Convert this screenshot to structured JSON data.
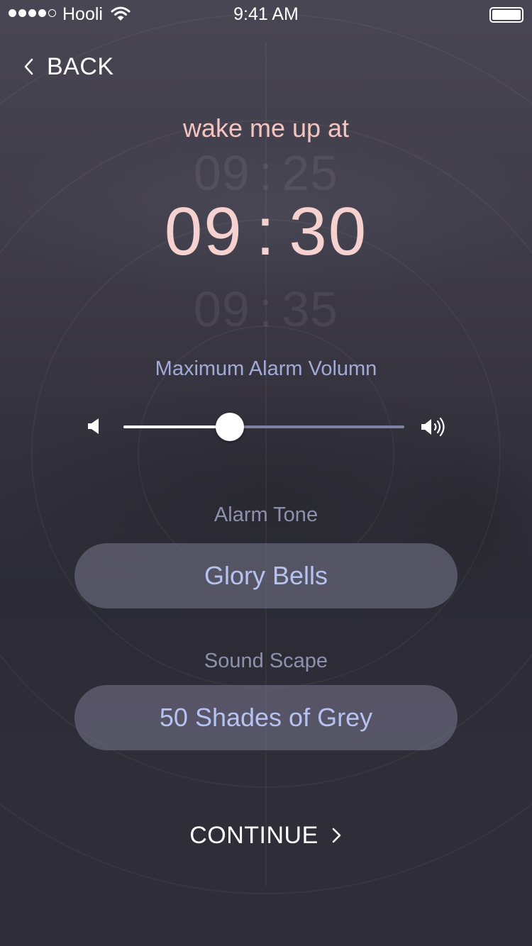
{
  "status_bar": {
    "carrier": "Hooli",
    "time": "9:41 AM",
    "battery_level": 1.0
  },
  "nav": {
    "back_label": "BACK"
  },
  "alarm": {
    "heading": "wake me up at",
    "prev": {
      "hour": "09",
      "minute": "25"
    },
    "current": {
      "hour": "09",
      "minute": "30"
    },
    "next": {
      "hour": "09",
      "minute": "35"
    },
    "separator": ":"
  },
  "volume": {
    "label": "Maximum Alarm Volumn",
    "level": 0.38
  },
  "tone": {
    "label": "Alarm Tone",
    "value": "Glory Bells"
  },
  "soundscape": {
    "label": "Sound Scape",
    "value": "50 Shades of Grey"
  },
  "continue_label": "CONTINUE",
  "icons": {
    "back": "chevron-left-icon",
    "continue": "chevron-right-icon",
    "volume_min": "speaker-low-icon",
    "volume_max": "speaker-high-icon"
  },
  "colors": {
    "heading": "#f3c4c0",
    "time": "#f5d2cf",
    "label_accent": "#a2aad8",
    "pill_text": "#b6c2f0"
  }
}
